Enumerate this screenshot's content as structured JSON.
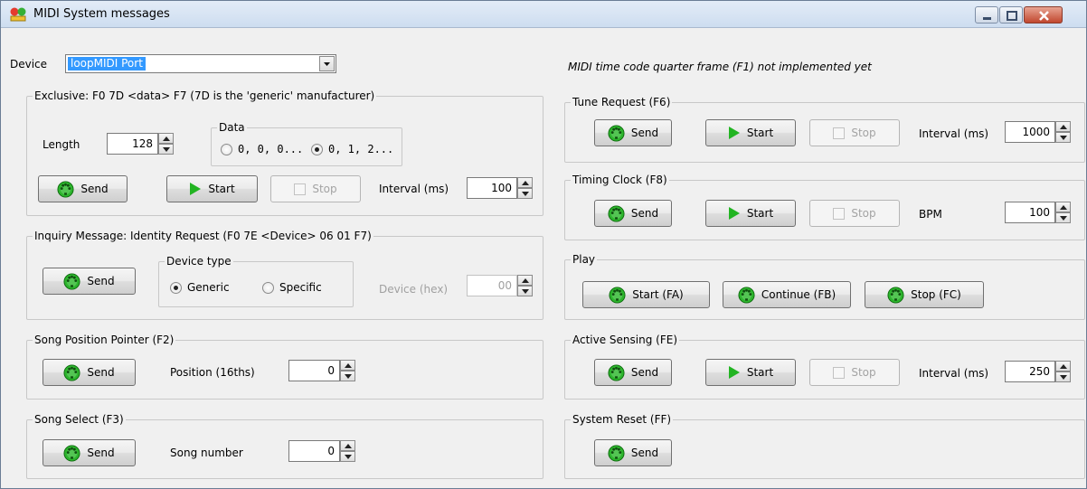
{
  "window": {
    "title": "MIDI System messages"
  },
  "device": {
    "label": "Device",
    "value": "loopMIDI Port"
  },
  "f1_note": "MIDI time code quarter frame (F1) not implemented yet",
  "exclusive": {
    "title": "Exclusive: F0 7D <data> F7 (7D is the 'generic' manufacturer)",
    "length_label": "Length",
    "length_value": "128",
    "data_group": "Data",
    "data_options": [
      "0, 0, 0...",
      "0, 1, 2..."
    ],
    "data_selected": "0, 1, 2...",
    "send": "Send",
    "start": "Start",
    "stop": "Stop",
    "interval_label": "Interval (ms)",
    "interval_value": "100"
  },
  "inquiry": {
    "title": "Inquiry Message: Identity Request (F0 7E <Device> 06 01 F7)",
    "send": "Send",
    "device_type_group": "Device type",
    "device_type_options": [
      "Generic",
      "Specific"
    ],
    "device_type_selected": "Generic",
    "device_hex_label": "Device (hex)",
    "device_hex_value": "00"
  },
  "song_position": {
    "title": "Song Position Pointer (F2)",
    "send": "Send",
    "position_label": "Position (16ths)",
    "position_value": "0"
  },
  "song_select": {
    "title": "Song Select (F3)",
    "send": "Send",
    "number_label": "Song number",
    "number_value": "0"
  },
  "tune_request": {
    "title": "Tune Request (F6)",
    "send": "Send",
    "start": "Start",
    "stop": "Stop",
    "interval_label": "Interval (ms)",
    "interval_value": "1000"
  },
  "timing_clock": {
    "title": "Timing Clock (F8)",
    "send": "Send",
    "start": "Start",
    "stop": "Stop",
    "bpm_label": "BPM",
    "bpm_value": "100"
  },
  "play": {
    "title": "Play",
    "start": "Start (FA)",
    "continue": "Continue (FB)",
    "stop": "Stop (FC)"
  },
  "active_sensing": {
    "title": "Active Sensing (FE)",
    "send": "Send",
    "start": "Start",
    "stop": "Stop",
    "interval_label": "Interval (ms)",
    "interval_value": "250"
  },
  "system_reset": {
    "title": "System Reset (FF)",
    "send": "Send"
  },
  "icons": {
    "app": "midi-app-icon",
    "midi_connector": "midi-din-icon",
    "play": "play-triangle-icon",
    "stop_check": "checkbox-icon"
  },
  "colors": {
    "midi_green": "#2db52d",
    "play_green": "#22b422",
    "titlebar": "#d6e3f3",
    "close_red": "#c8503a",
    "selection": "#3399ff"
  }
}
